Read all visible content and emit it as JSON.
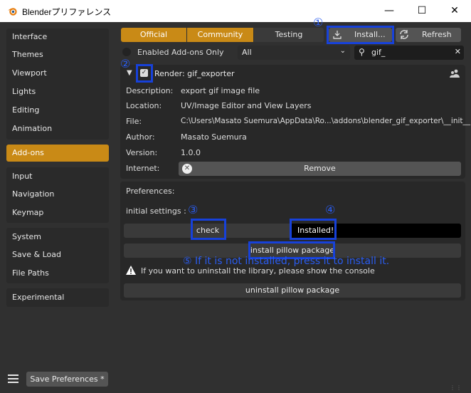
{
  "window": {
    "title": "Blenderプリファレンス",
    "minimize_icon": "minimize-icon",
    "maximize_icon": "maximize-icon",
    "close_icon": "close-icon"
  },
  "sidebar": {
    "group1": [
      "Interface",
      "Themes",
      "Viewport",
      "Lights",
      "Editing",
      "Animation"
    ],
    "active": "Add-ons",
    "group2": [
      "Input",
      "Navigation",
      "Keymap"
    ],
    "group3": [
      "System",
      "Save & Load",
      "File Paths"
    ],
    "group4": [
      "Experimental"
    ],
    "save_button": "Save Preferences *"
  },
  "tabs": {
    "official": "Official",
    "community": "Community",
    "testing": "Testing"
  },
  "toolbar": {
    "install": "Install...",
    "refresh": "Refresh"
  },
  "filter": {
    "enabled_only": "Enabled Add-ons Only",
    "category": "All",
    "search_value": "gif_"
  },
  "addon": {
    "title": "Render: gif_exporter",
    "fields": [
      {
        "label": "Description:",
        "value": "export gif image file"
      },
      {
        "label": "Location:",
        "value": "UV/Image Editor and View Layers"
      },
      {
        "label": "File:",
        "value": "C:\\Users\\Masato Suemura\\AppData\\Ro...\\addons\\blender_gif_exporter\\__init__.py"
      },
      {
        "label": "Author:",
        "value": "Masato Suemura"
      },
      {
        "label": "Version:",
        "value": "1.0.0"
      }
    ],
    "internet_label": "Internet:",
    "remove": "Remove"
  },
  "prefs": {
    "title": "Preferences:",
    "initial": "initial settings :",
    "check": "check",
    "installed": "Installed!",
    "install_pillow": "install pillow package",
    "warning": "If you want to uninstall the library, please show the console",
    "uninstall_pillow": "uninstall pillow package"
  },
  "annotations": {
    "n1": "①",
    "n2": "②",
    "n3": "③",
    "n4": "④",
    "n5": "⑤ If it is not installed, press it to install it.",
    "color": "#1741d9"
  },
  "colors": {
    "accent": "#c98a16",
    "background": "#303030"
  }
}
